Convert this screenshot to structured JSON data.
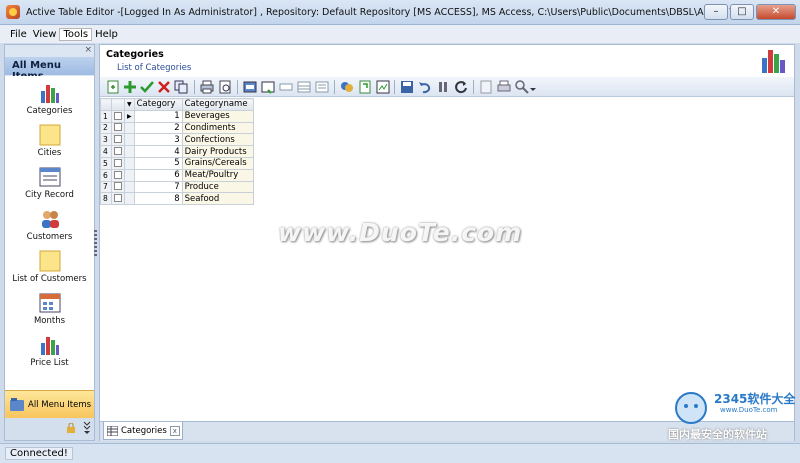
{
  "window": {
    "title": "Active Table Editor -[Logged In As Administrator] , Repository: Default Repository [MS ACCESS], MS Access, C:\\Users\\Public\\Documents\\DBSL\\Active Table Editor...",
    "minimize": "–",
    "maximize": "□",
    "close": "✕"
  },
  "menu": [
    "File",
    "View",
    "Tools",
    "Help"
  ],
  "left_panel": {
    "close": "×",
    "header": "All Menu Items",
    "items": [
      {
        "label": "Categories",
        "icon": "bar-chart-icon"
      },
      {
        "label": "Cities",
        "icon": "note-icon"
      },
      {
        "label": "City Record",
        "icon": "form-icon"
      },
      {
        "label": "Customers",
        "icon": "users-icon"
      },
      {
        "label": "List of Customers",
        "icon": "note-icon"
      },
      {
        "label": "Months",
        "icon": "calendar-icon"
      },
      {
        "label": "Price List",
        "icon": "bar-chart-icon"
      }
    ],
    "scroll": "▼",
    "active_group": "All Menu Items"
  },
  "main": {
    "title": "Categories",
    "subtitle": "List of Categories",
    "grid": {
      "columns": [
        "Category",
        "Categoryname"
      ],
      "rows": [
        {
          "n": "1",
          "id": "1",
          "name": "Beverages"
        },
        {
          "n": "2",
          "id": "2",
          "name": "Condiments"
        },
        {
          "n": "3",
          "id": "3",
          "name": "Confections"
        },
        {
          "n": "4",
          "id": "4",
          "name": "Dairy Products"
        },
        {
          "n": "5",
          "id": "5",
          "name": "Grains/Cereals"
        },
        {
          "n": "6",
          "id": "6",
          "name": "Meat/Poultry"
        },
        {
          "n": "7",
          "id": "7",
          "name": "Produce"
        },
        {
          "n": "8",
          "id": "8",
          "name": "Seafood"
        }
      ]
    },
    "tab": "Categories",
    "tab_close": "x"
  },
  "status": "Connected!",
  "watermark": {
    "main": "www.DuoTe.com",
    "brand": "2345软件大全",
    "brand_url": "www.DuoTe.com",
    "slogan": "国内最安全的软件站"
  },
  "colors": {
    "accent": "#f8c55d",
    "header": "#9ebbe2",
    "link": "#2a4c9a"
  }
}
